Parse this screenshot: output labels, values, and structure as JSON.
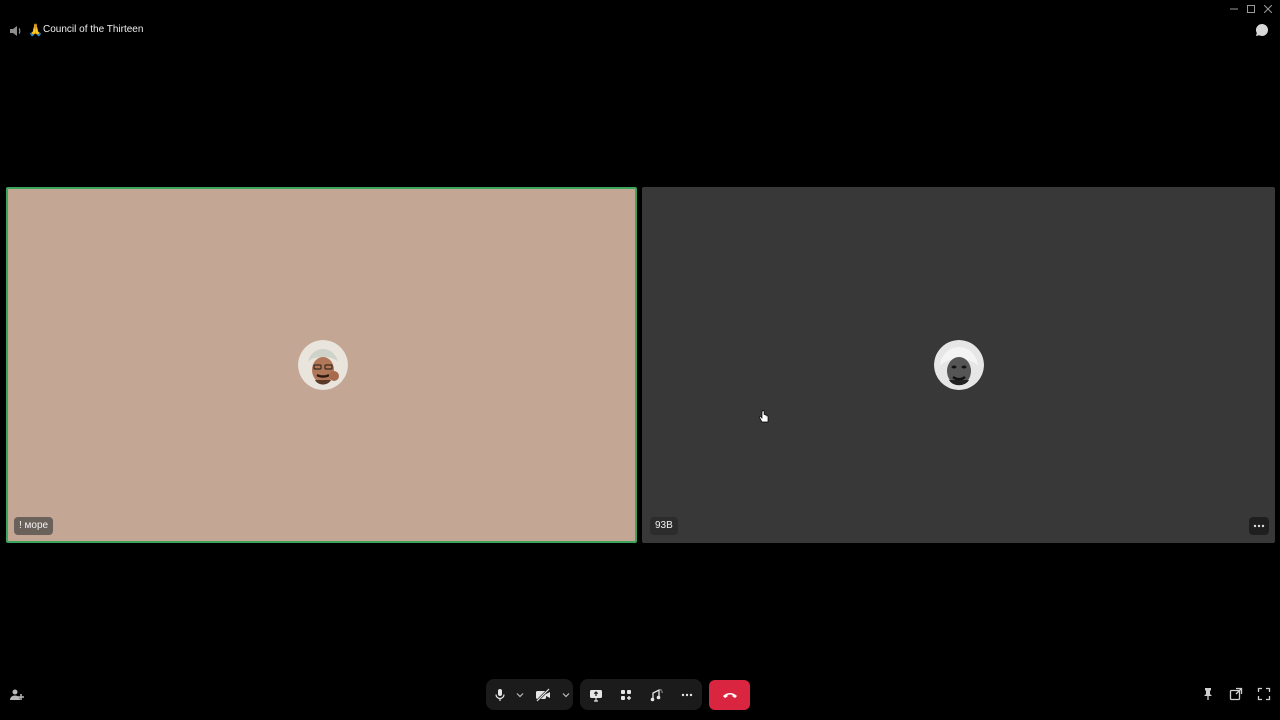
{
  "titlebar": {
    "channel_emoji": "🙏",
    "channel_title": "Council of the Thirteen",
    "window_controls": [
      "minimize-icon",
      "maximize-icon",
      "close-icon"
    ],
    "chat_icon": "chat-bubble-icon"
  },
  "tiles": [
    {
      "name": "! море",
      "speaking": true,
      "background": "#c4a694",
      "border": "#3ba55c",
      "avatar_icon": "user-avatar"
    },
    {
      "name": "93B",
      "speaking": false,
      "background": "#383838",
      "avatar_icon": "user-avatar",
      "more_icon": "ellipsis-icon"
    }
  ],
  "controls": {
    "mic_icon": "microphone-icon",
    "camera_icon": "camera-off-icon",
    "screenshare_icon": "screen-share-icon",
    "activities_icon": "activities-icon",
    "soundboard_icon": "soundboard-icon",
    "more_icon": "ellipsis-icon",
    "hangup_icon": "hangup-icon"
  },
  "colors": {
    "hangup": "#d9253f",
    "speaking_border": "#3ba55c",
    "control_bg": "#1b1b1b"
  }
}
